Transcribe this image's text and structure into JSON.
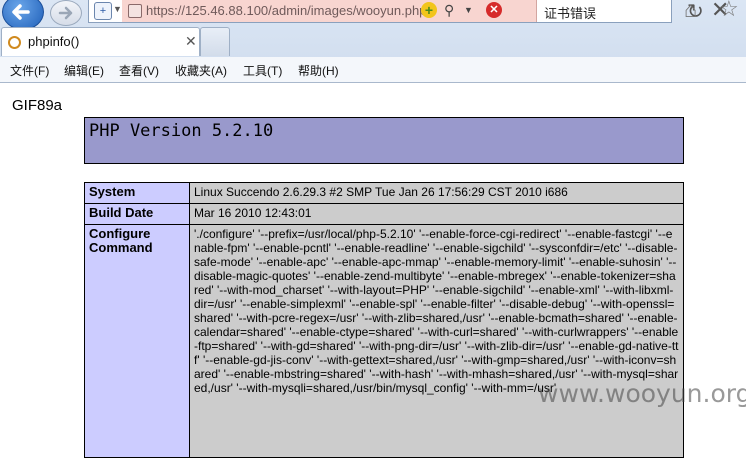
{
  "browser": {
    "url": "https://125.46.88.100/admin/images/wooyun.php",
    "cert_error": "证书错误",
    "tab_title": "phpinfo()"
  },
  "menu": [
    {
      "label": "文件(F)"
    },
    {
      "label": "编辑(E)"
    },
    {
      "label": "查看(V)"
    },
    {
      "label": "收藏夹(A)"
    },
    {
      "label": "工具(T)"
    },
    {
      "label": "帮助(H)"
    }
  ],
  "page": {
    "gif_header": "GIF89a",
    "php_version": "PHP Version 5.2.10",
    "rows": [
      {
        "key": "System",
        "value": "Linux Succendo 2.6.29.3 #2 SMP Tue Jan 26 17:56:29 CST 2010 i686"
      },
      {
        "key": "Build Date",
        "value": "Mar 16 2010 12:43:01"
      },
      {
        "key": "Configure Command",
        "value": "'./configure' '--prefix=/usr/local/php-5.2.10' '--enable-force-cgi-redirect' '--enable-fastcgi' '--enable-fpm' '--enable-pcntl' '--enable-readline' '--enable-sigchild' '--sysconfdir=/etc' '--disable-safe-mode' '--enable-apc' '--enable-apc-mmap' '--enable-memory-limit' '--enable-suhosin' '--disable-magic-quotes' '--enable-zend-multibyte' '--enable-mbregex' '--enable-tokenizer=shared' '--with-mod_charset' '--with-layout=PHP' '--enable-sigchild' '--enable-xml' '--with-libxml-dir=/usr' '--enable-simplexml' '--enable-spl' '--enable-filter' '--disable-debug' '--with-openssl=shared' '--with-pcre-regex=/usr' '--with-zlib=shared,/usr' '--enable-bcmath=shared' '--enable-calendar=shared' '--enable-ctype=shared' '--with-curl=shared' '--with-curlwrappers' '--enable-ftp=shared' '--with-gd=shared' '--with-png-dir=/usr' '--with-zlib-dir=/usr' '--enable-gd-native-ttf' '--enable-gd-jis-conv' '--with-gettext=shared,/usr' '--with-gmp=shared,/usr' '--with-iconv=shared' '--enable-mbstring=shared' '--with-hash' '--with-mhash=shared,/usr' '--with-mysql=shared,/usr' '--with-mysqli=shared,/usr/bin/mysql_config' '--with-mm=/usr'"
      }
    ]
  },
  "watermark": "www.wooyun.org"
}
